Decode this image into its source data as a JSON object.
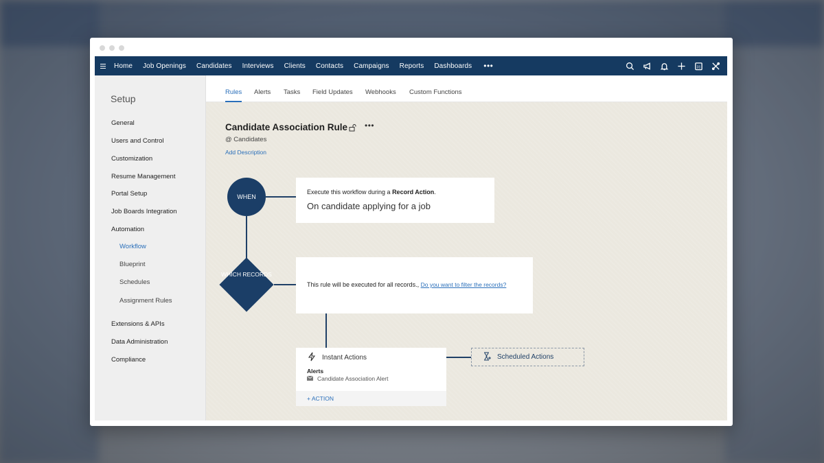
{
  "nav": {
    "items": [
      "Home",
      "Job Openings",
      "Candidates",
      "Interviews",
      "Clients",
      "Contacts",
      "Campaigns",
      "Reports",
      "Dashboards"
    ],
    "more": "•••",
    "calendar_day": "31"
  },
  "sidebar": {
    "title": "Setup",
    "items": [
      "General",
      "Users and Control",
      "Customization",
      "Resume Management",
      "Portal Setup",
      "Job Boards Integration",
      "Automation"
    ],
    "automation_sub": [
      "Workflow",
      "Blueprint",
      "Schedules",
      "Assignment Rules"
    ],
    "items_after": [
      "Extensions & APIs",
      "Data Administration",
      "Compliance"
    ],
    "active": "Workflow"
  },
  "tabs": [
    "Rules",
    "Alerts",
    "Tasks",
    "Field Updates",
    "Webhooks",
    "Custom Functions"
  ],
  "active_tab": "Rules",
  "rule": {
    "title": "Candidate Association Rule",
    "more": "•••",
    "module": "@ Candidates",
    "add_description": "Add Description"
  },
  "flow": {
    "when_label": "WHEN",
    "when_line1_prefix": "Execute this workflow during a ",
    "when_line1_bold": "Record Action",
    "when_line1_suffix": ".",
    "when_line2": "On candidate applying for a job",
    "which_label": "WHICH RECORDS",
    "which_text": "This rule will be executed for all records.,",
    "which_link": "Do you want to filter the records?",
    "instant_title": "Instant Actions",
    "alerts_heading": "Alerts",
    "alert_name": "Candidate Association Alert",
    "add_action": "+ ACTION",
    "scheduled_title": "Scheduled Actions"
  },
  "colors": {
    "nav_bg": "#153a61",
    "accent": "#2a6fba",
    "node": "#1b3e67",
    "canvas_bg": "#ebe8df"
  }
}
